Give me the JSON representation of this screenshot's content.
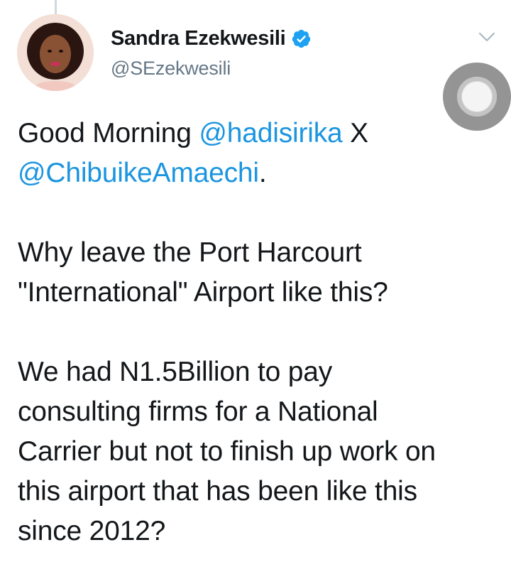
{
  "tweet": {
    "author": {
      "display_name": "Sandra Ezekwesili",
      "handle": "@SEzekwesili",
      "verified": true
    },
    "paragraph1": {
      "prefix": "Good Morning ",
      "mention1": "@hadisirika",
      "middle": " X",
      "mention2": "@ChibuikeAmaechi",
      "suffix": "."
    },
    "paragraph2_line1": "Why leave the Port Harcourt",
    "paragraph2_line2": "\"International\" Airport like this?",
    "paragraph3_line1": "We had N1.5Billion to pay",
    "paragraph3_line2": "consulting firms for a National",
    "paragraph3_line3": "Carrier but not to finish up work on",
    "paragraph3_line4": "this airport that has been like this",
    "paragraph3_line5": "since 2012?"
  },
  "colors": {
    "mention": "#1b95e0",
    "verified": "#1da1f2",
    "text": "#14171a",
    "secondary": "#657786"
  },
  "icons": {
    "verified": "verified-badge-icon",
    "more": "chevron-down-icon",
    "overlay": "assistive-touch-icon"
  }
}
